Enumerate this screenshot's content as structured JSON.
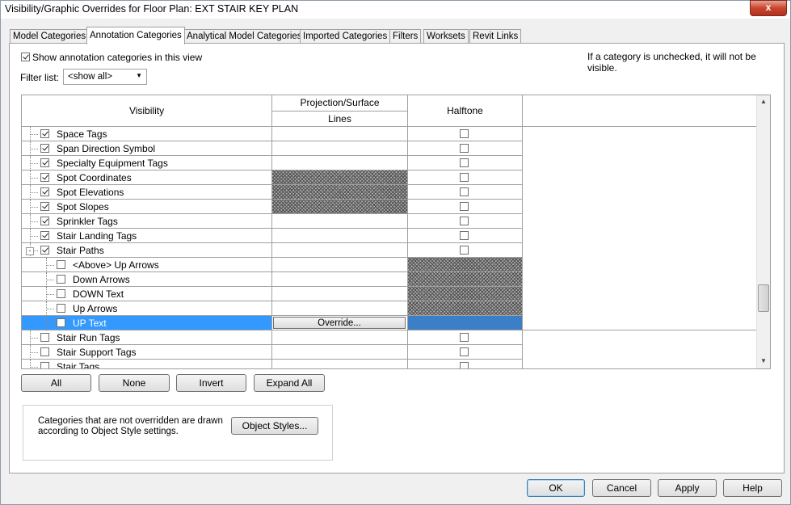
{
  "window": {
    "title": "Visibility/Graphic Overrides for Floor Plan: EXT STAIR KEY PLAN",
    "close_label": "x"
  },
  "tabs": [
    {
      "label": "Model Categories",
      "active": false
    },
    {
      "label": "Annotation Categories",
      "active": true
    },
    {
      "label": "Analytical Model Categories",
      "active": false
    },
    {
      "label": "Imported Categories",
      "active": false
    },
    {
      "label": "Filters",
      "active": false
    },
    {
      "label": "Worksets",
      "active": false
    },
    {
      "label": "Revit Links",
      "active": false
    }
  ],
  "panel": {
    "show_checkbox_label": "Show annotation categories in this view",
    "show_checked": true,
    "hint": "If a category is unchecked, it will not be visible.",
    "filter_label": "Filter list:",
    "filter_value": "<show all>"
  },
  "grid": {
    "headers": {
      "visibility": "Visibility",
      "projection_surface": "Projection/Surface",
      "lines": "Lines",
      "halftone": "Halftone"
    },
    "override_label": "Override...",
    "rows": [
      {
        "label": "Space Tags",
        "checked": true,
        "level": 0,
        "lines": "normal",
        "halftone": "box"
      },
      {
        "label": "Span Direction Symbol",
        "checked": true,
        "level": 0,
        "lines": "normal",
        "halftone": "box"
      },
      {
        "label": "Specialty Equipment Tags",
        "checked": true,
        "level": 0,
        "lines": "normal",
        "halftone": "box"
      },
      {
        "label": "Spot Coordinates",
        "checked": true,
        "level": 0,
        "lines": "hatch",
        "halftone": "box"
      },
      {
        "label": "Spot Elevations",
        "checked": true,
        "level": 0,
        "lines": "hatch",
        "halftone": "box"
      },
      {
        "label": "Spot Slopes",
        "checked": true,
        "level": 0,
        "lines": "hatch",
        "halftone": "box"
      },
      {
        "label": "Sprinkler Tags",
        "checked": true,
        "level": 0,
        "lines": "normal",
        "halftone": "box"
      },
      {
        "label": "Stair Landing Tags",
        "checked": true,
        "level": 0,
        "lines": "normal",
        "halftone": "box"
      },
      {
        "label": "Stair Paths",
        "checked": true,
        "level": 0,
        "expander": "-",
        "lines": "normal",
        "halftone": "box"
      },
      {
        "label": "<Above> Up Arrows",
        "checked": false,
        "level": 1,
        "lines": "normal",
        "halftone": "hatch"
      },
      {
        "label": "Down Arrows",
        "checked": false,
        "level": 1,
        "lines": "normal",
        "halftone": "hatch"
      },
      {
        "label": "DOWN Text",
        "checked": false,
        "level": 1,
        "lines": "normal",
        "halftone": "hatch"
      },
      {
        "label": "Up Arrows",
        "checked": false,
        "level": 1,
        "lines": "normal",
        "halftone": "hatch"
      },
      {
        "label": "UP Text",
        "checked": false,
        "level": 1,
        "lines": "override",
        "halftone": "selected",
        "selected": true
      },
      {
        "label": "Stair Run Tags",
        "checked": false,
        "level": 0,
        "lines": "normal",
        "halftone": "box"
      },
      {
        "label": "Stair Support Tags",
        "checked": false,
        "level": 0,
        "lines": "normal",
        "halftone": "box"
      },
      {
        "label": "Stair Tags",
        "checked": false,
        "level": 0,
        "lines": "normal",
        "halftone": "box"
      }
    ]
  },
  "grid_buttons": {
    "all": "All",
    "none": "None",
    "invert": "Invert",
    "expand_all": "Expand All"
  },
  "info": {
    "text_line1": "Categories that are not overridden are drawn",
    "text_line2": "according to Object Style settings.",
    "object_styles_label": "Object Styles..."
  },
  "footer": {
    "ok": "OK",
    "cancel": "Cancel",
    "apply": "Apply",
    "help": "Help"
  },
  "colors": {
    "selection": "#3399ff",
    "close": "#c9452e"
  }
}
